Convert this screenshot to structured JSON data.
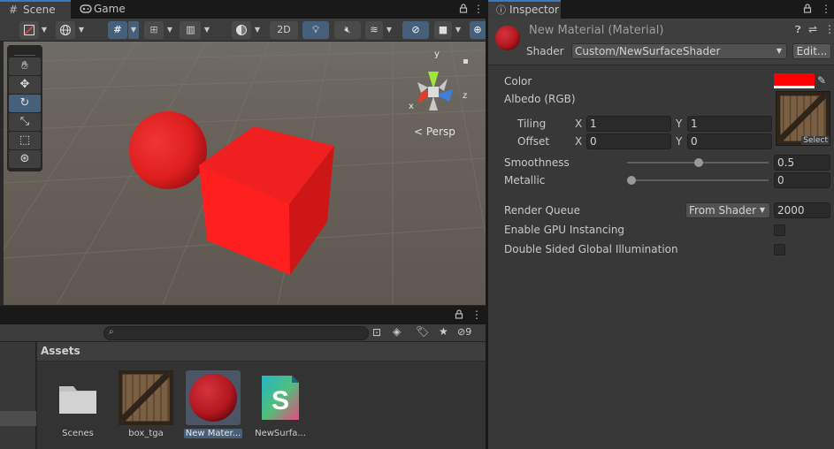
{
  "scene_tabs": [
    {
      "label": "Scene",
      "icon": "grid-icon"
    },
    {
      "label": "Game",
      "icon": "gamepad-icon"
    }
  ],
  "scene_toolbar": {
    "btn_2d": "2D",
    "persp_label": "< Persp",
    "gizmo_axes": {
      "x": "x",
      "y": "y",
      "z": "z"
    }
  },
  "project": {
    "search_placeholder": "",
    "hidden_count": "9",
    "assets_header": "Assets",
    "assets": [
      {
        "label": "Scenes",
        "icon": "folder-icon"
      },
      {
        "label": "box_tga",
        "icon": "crate-texture-icon"
      },
      {
        "label": "New Mater...",
        "icon": "material-sphere-icon"
      },
      {
        "label": "NewSurfa...",
        "icon": "shader-icon"
      }
    ]
  },
  "inspector": {
    "tab_label": "Inspector",
    "title": "New Material (Material)",
    "shader_label": "Shader",
    "shader_value": "Custom/NewSurfaceShader",
    "edit_button": "Edit...",
    "color_label": "Color",
    "color_value": "#ff0000",
    "albedo_label": "Albedo (RGB)",
    "tiling_label": "Tiling",
    "offset_label": "Offset",
    "x_label": "X",
    "y_label": "Y",
    "tiling_x": "1",
    "tiling_y": "1",
    "offset_x": "0",
    "offset_y": "0",
    "select_label": "Select",
    "smoothness_label": "Smoothness",
    "smoothness_value": "0.5",
    "metallic_label": "Metallic",
    "metallic_value": "0",
    "render_queue_label": "Render Queue",
    "render_queue_mode": "From Shader",
    "render_queue_value": "2000",
    "gpu_instancing_label": "Enable GPU Instancing",
    "gpu_instancing_checked": false,
    "double_sided_gi_label": "Double Sided Global Illumination",
    "double_sided_gi_checked": false
  },
  "colors": {
    "accent_blue": "#3a79bb",
    "selected_bg": "#46607c",
    "object_red": "#e82323"
  }
}
